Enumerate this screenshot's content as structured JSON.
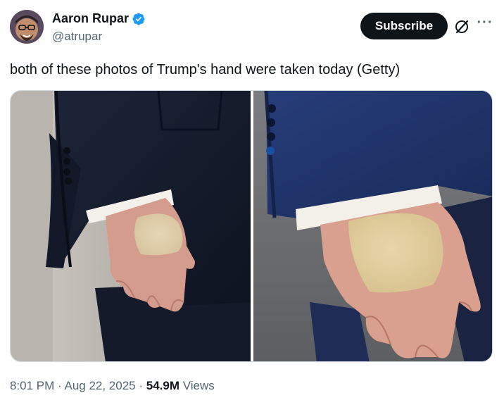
{
  "author": {
    "name": "Aaron Rupar",
    "handle": "@atrupar",
    "verified": true
  },
  "actions": {
    "subscribe_label": "Subscribe",
    "grok_icon": "grok-icon",
    "more_icon": "more-icon",
    "more_glyph": "···"
  },
  "tweet": {
    "text": "both of these photos of Trump's hand were taken today (Getty)"
  },
  "media": {
    "count": 2
  },
  "meta": {
    "time": "8:01 PM",
    "sep1": " · ",
    "date": "Aug 22, 2025",
    "sep2": " · ",
    "views_count": "54.9M",
    "views_label": " Views"
  },
  "colors": {
    "text_primary": "#0f1419",
    "text_secondary": "#536471",
    "verified_blue": "#1d9bf0",
    "button_bg": "#0f1419"
  }
}
